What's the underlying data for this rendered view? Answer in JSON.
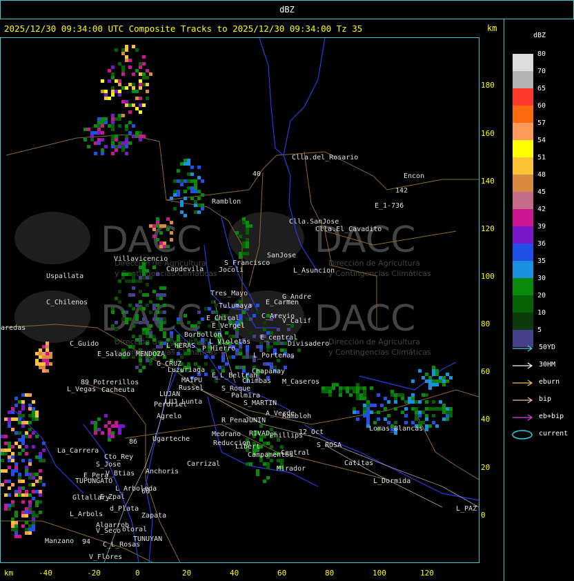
{
  "window": {
    "title": "dBZ"
  },
  "header": {
    "text": "2025/12/30 09:34:00 UTC Composite Tracks to 2025/12/30 09:34:00 Tz 35",
    "km_label": "km"
  },
  "watermark": {
    "logo_text": "DACC",
    "subtitle_line1": "Dirección de Agricultura",
    "subtitle_line2": "y Contingencias Climáticas"
  },
  "legend": {
    "title": "dBZ",
    "levels": [
      {
        "label": "80",
        "color": "#dcdcdc"
      },
      {
        "label": "70",
        "color": "#b4b4b4"
      },
      {
        "label": "65",
        "color": "#ff3a2a"
      },
      {
        "label": "60",
        "color": "#ff6a10"
      },
      {
        "label": "57",
        "color": "#ff9a5a"
      },
      {
        "label": "54",
        "color": "#ffff00"
      },
      {
        "label": "51",
        "color": "#fcc236"
      },
      {
        "label": "48",
        "color": "#d88b40"
      },
      {
        "label": "45",
        "color": "#c46b8a"
      },
      {
        "label": "42",
        "color": "#cc1590"
      },
      {
        "label": "39",
        "color": "#7a18c8"
      },
      {
        "label": "36",
        "color": "#2050e8"
      },
      {
        "label": "35",
        "color": "#1a90e0"
      },
      {
        "label": "30",
        "color": "#0a8a0a"
      },
      {
        "label": "20",
        "color": "#046204"
      },
      {
        "label": "10",
        "color": "#0c3a0c"
      },
      {
        "label": "5",
        "color": "#46408a"
      }
    ],
    "tracks": [
      {
        "label": "50YD",
        "color": "#4fd0e0"
      },
      {
        "label": "30HM",
        "color": "#ffffff"
      },
      {
        "label": "eburn",
        "color": "#f0c060"
      },
      {
        "label": "bip",
        "color": "#f4c0b0"
      },
      {
        "label": "eb+bip",
        "color": "#e040e0"
      },
      {
        "label": "current",
        "color": "#2ad0f0"
      }
    ]
  },
  "axes": {
    "x_label": "km",
    "x_ticks": [
      "-40",
      "-20",
      "0",
      "20",
      "40",
      "60",
      "80",
      "100",
      "120"
    ],
    "y_ticks": [
      "180",
      "160",
      "140",
      "120",
      "100",
      "80",
      "60",
      "40",
      "20",
      "0"
    ]
  },
  "places": [
    {
      "name": "Clla.del_Rosario"
    },
    {
      "name": "Encon"
    },
    {
      "name": "142"
    },
    {
      "name": "E_1-736"
    },
    {
      "name": "Ramblon"
    },
    {
      "name": "Clla.SanJose"
    },
    {
      "name": "Clla.El_Cavadito"
    },
    {
      "name": "Villavicencio"
    },
    {
      "name": "Capdevila"
    },
    {
      "name": "S_Francisco"
    },
    {
      "name": "Jocoli"
    },
    {
      "name": "SanJose"
    },
    {
      "name": "L_Asuncion"
    },
    {
      "name": "Uspallata"
    },
    {
      "name": "Tres_Mayo"
    },
    {
      "name": "G_Andre"
    },
    {
      "name": "C_Chilenos"
    },
    {
      "name": "E_Carmen"
    },
    {
      "name": "Tulumaya"
    },
    {
      "name": "C_Arevio"
    },
    {
      "name": "E_Chical"
    },
    {
      "name": "V_Calif"
    },
    {
      "name": "E_Vergel"
    },
    {
      "name": "Borbollon"
    },
    {
      "name": "L_Violetas"
    },
    {
      "name": "E_central"
    },
    {
      "name": "Divisadero"
    },
    {
      "name": "aredas"
    },
    {
      "name": "C_Guido"
    },
    {
      "name": "L_HERAS"
    },
    {
      "name": "P_Hierro"
    },
    {
      "name": "E_Salado"
    },
    {
      "name": "MENDOZA"
    },
    {
      "name": "L_Portenas"
    },
    {
      "name": "G_CRUZ"
    },
    {
      "name": "Luzuriaga"
    },
    {
      "name": "Chapanay"
    },
    {
      "name": "E_L_Beltran"
    },
    {
      "name": "Chimbas"
    },
    {
      "name": "M_Caseros"
    },
    {
      "name": "MAIPU"
    },
    {
      "name": "Potrerillos"
    },
    {
      "name": "Russel"
    },
    {
      "name": "S_Roque"
    },
    {
      "name": "L_Vegas"
    },
    {
      "name": "Cacheuta"
    },
    {
      "name": "LUJAN"
    },
    {
      "name": "Palmira"
    },
    {
      "name": "LUJ_Lunta"
    },
    {
      "name": "S_MARTIN"
    },
    {
      "name": "Perdriel"
    },
    {
      "name": "A_Verde"
    },
    {
      "name": "Agrelo"
    },
    {
      "name": "R_Pena"
    },
    {
      "name": "JUNIN"
    },
    {
      "name": "Rambloh"
    },
    {
      "name": "Lomas_Blancas"
    },
    {
      "name": "Ugarteche"
    },
    {
      "name": "Medrano"
    },
    {
      "name": "RIVAD"
    },
    {
      "name": "Phillips"
    },
    {
      "name": "12_Oct"
    },
    {
      "name": "Reduccion"
    },
    {
      "name": "S_ROSA"
    },
    {
      "name": "La_Carrera"
    },
    {
      "name": "Cto_Rey"
    },
    {
      "name": "Libert"
    },
    {
      "name": "S_Jose"
    },
    {
      "name": "Campamentos"
    },
    {
      "name": "Central"
    },
    {
      "name": "Carrizal"
    },
    {
      "name": "Catitas"
    },
    {
      "name": "Anchoris"
    },
    {
      "name": "V_Btias"
    },
    {
      "name": "E_Pera"
    },
    {
      "name": "Mirador"
    },
    {
      "name": "TUPUNGATO"
    },
    {
      "name": "L_Dormida"
    },
    {
      "name": "L_Arboleda"
    },
    {
      "name": "E_Zpal"
    },
    {
      "name": "Gltallary"
    },
    {
      "name": "d_Plata"
    },
    {
      "name": "L_PAZ"
    },
    {
      "name": "L_Arbols"
    },
    {
      "name": "Zapata"
    },
    {
      "name": "Algarrob"
    },
    {
      "name": "V_Seco"
    },
    {
      "name": "otoral"
    },
    {
      "name": "TUNUYAN"
    },
    {
      "name": "Manzano"
    },
    {
      "name": "C_L_Rosas"
    },
    {
      "name": "V_Flores"
    },
    {
      "name": "89"
    },
    {
      "name": "86"
    },
    {
      "name": "40"
    },
    {
      "name": "94"
    },
    {
      "name": "60"
    }
  ]
}
